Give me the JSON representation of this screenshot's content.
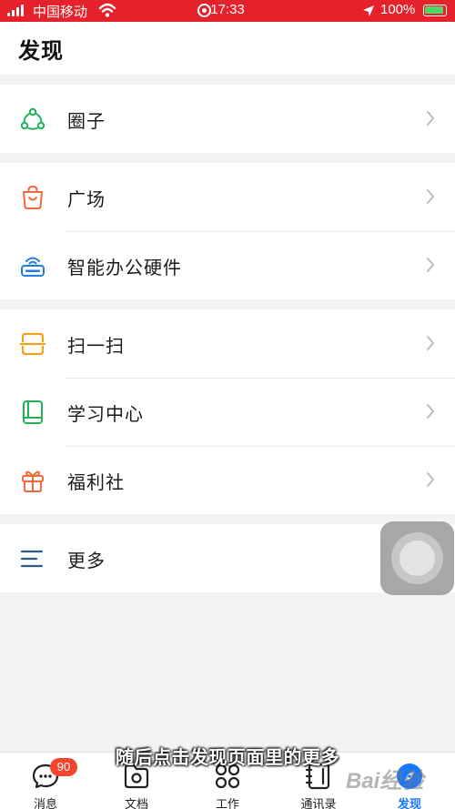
{
  "status_bar": {
    "carrier": "中国移动",
    "time": "17:33",
    "battery": "100%"
  },
  "header": {
    "title": "发现"
  },
  "sections": [
    {
      "items": [
        {
          "label": "圈子",
          "icon": "circle-group-icon",
          "color": "#20b35a"
        }
      ]
    },
    {
      "items": [
        {
          "label": "广场",
          "icon": "shopping-bag-icon",
          "color": "#f06a3b"
        },
        {
          "label": "智能办公硬件",
          "icon": "router-device-icon",
          "color": "#1f7fe0"
        }
      ]
    },
    {
      "items": [
        {
          "label": "扫一扫",
          "icon": "scan-icon",
          "color": "#f1a31a"
        },
        {
          "label": "学习中心",
          "icon": "book-icon",
          "color": "#20b35a"
        },
        {
          "label": "福利社",
          "icon": "gift-icon",
          "color": "#f06a3b"
        }
      ]
    },
    {
      "items": [
        {
          "label": "更多",
          "icon": "menu-lines-icon",
          "color": "#2e5c8a"
        }
      ]
    }
  ],
  "tabbar": {
    "tabs": [
      {
        "label": "消息",
        "icon": "chat-bubble-icon",
        "badge": "90"
      },
      {
        "label": "文档",
        "icon": "document-folder-icon"
      },
      {
        "label": "工作",
        "icon": "apps-grid-icon"
      },
      {
        "label": "通讯录",
        "icon": "contacts-book-icon"
      },
      {
        "label": "发现",
        "icon": "discover-icon",
        "active": true
      }
    ],
    "active_color": "#1677ff"
  },
  "overlay": {
    "subtitle": "随后点击发现页面里的更多",
    "watermark": "Bai经验"
  }
}
